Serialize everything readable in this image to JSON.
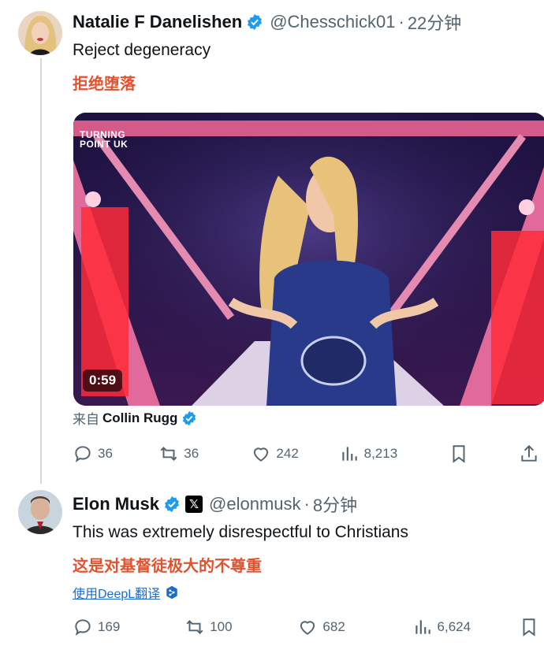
{
  "tweet1": {
    "name": "Natalie F Danelishen",
    "handle": "@Chesschick01",
    "dot": "·",
    "time": "22分钟",
    "text": "Reject degeneracy",
    "translation": "拒绝堕落",
    "video": {
      "duration": "0:59",
      "watermark_line1": "TURNING",
      "watermark_line2": "POINT UK"
    },
    "source_prefix": "来自",
    "source_name": "Collin Rugg",
    "actions": {
      "replies": "36",
      "reposts": "36",
      "likes": "242",
      "views": "8,213"
    }
  },
  "tweet2": {
    "name": "Elon Musk",
    "handle": "@elonmusk",
    "dot": "·",
    "time": "8分钟",
    "text": "This was extremely disrespectful to Christians",
    "translation": "这是对基督徒极大的不尊重",
    "translate_link": "使用DeepL翻译",
    "actions": {
      "replies": "169",
      "reposts": "100",
      "likes": "682",
      "views": "6,624"
    }
  },
  "colors": {
    "verified": "#1d9bf0",
    "translation": "#e0532f",
    "link": "#1d6cc9",
    "muted": "#536471"
  }
}
